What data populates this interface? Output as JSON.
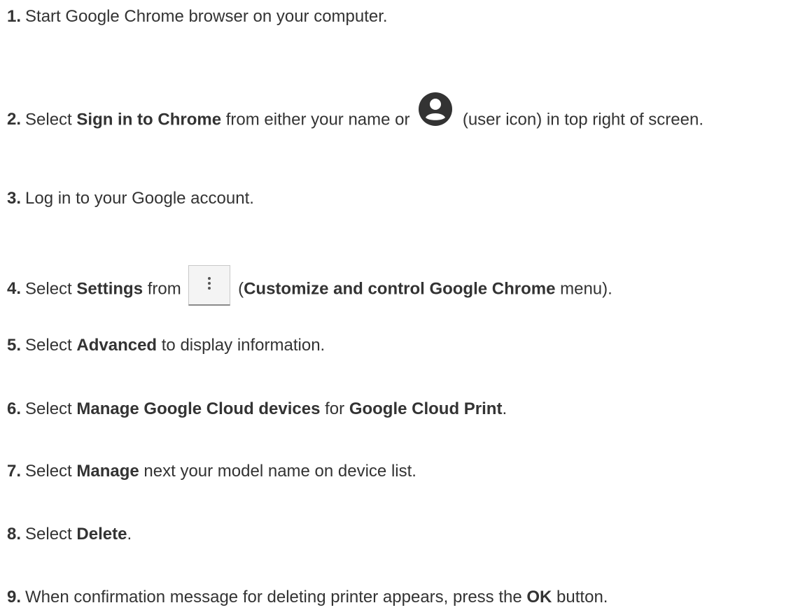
{
  "steps": [
    {
      "num": "1.",
      "parts": [
        "Start Google Chrome browser on your computer."
      ]
    },
    {
      "num": "2.",
      "parts": [
        "Select ",
        "Sign in to Chrome",
        " from either your name or ",
        " (user icon) in top right of screen."
      ],
      "icon": "user-icon"
    },
    {
      "num": "3.",
      "parts": [
        "Log in to your Google account."
      ]
    },
    {
      "num": "4.",
      "parts": [
        "Select ",
        "Settings",
        " from ",
        " (",
        "Customize and control Google Chrome",
        " menu)."
      ],
      "icon": "more-vert-menu-icon"
    },
    {
      "num": "5.",
      "parts": [
        "Select ",
        "Advanced",
        " to display information."
      ]
    },
    {
      "num": "6.",
      "parts": [
        "Select ",
        "Manage Google Cloud devices",
        " for ",
        "Google Cloud Print",
        "."
      ]
    },
    {
      "num": "7.",
      "parts": [
        "Select ",
        "Manage",
        " next your model name on device list."
      ]
    },
    {
      "num": "8.",
      "parts": [
        "Select ",
        "Delete",
        "."
      ]
    },
    {
      "num": "9.",
      "parts": [
        "When confirmation message for deleting printer appears, press the ",
        "OK",
        " button."
      ]
    }
  ]
}
